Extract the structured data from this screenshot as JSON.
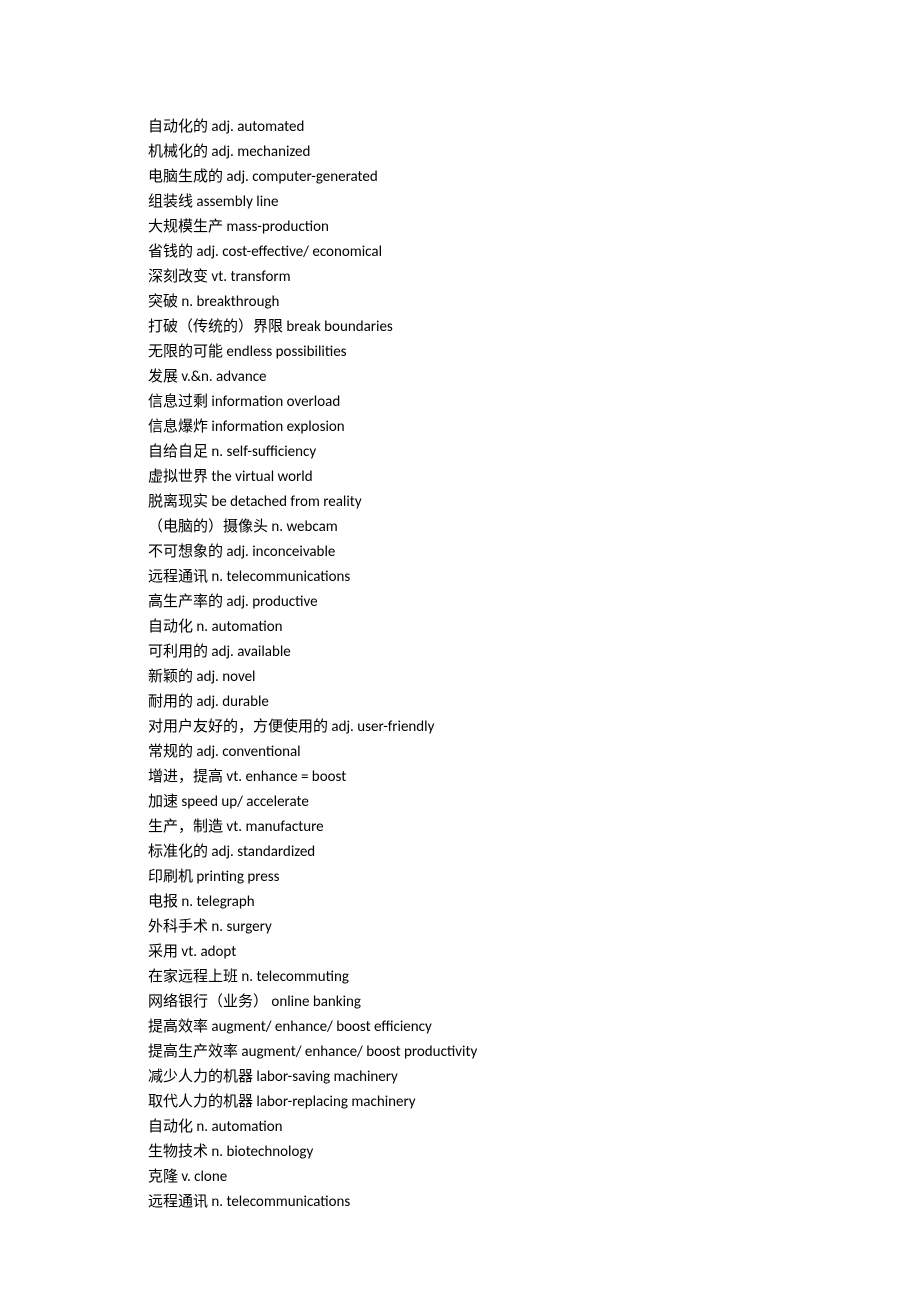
{
  "vocabulary": [
    {
      "cn": "自动化的",
      "en": " adj. automated"
    },
    {
      "cn": "机械化的",
      "en": " adj. mechanized"
    },
    {
      "cn": "电脑生成的",
      "en": " adj. computer-generated"
    },
    {
      "cn": "组装线",
      "en": " assembly line"
    },
    {
      "cn": "大规模生产",
      "en": " mass-production"
    },
    {
      "cn": "省钱的",
      "en": " adj. cost-effective/ economical"
    },
    {
      "cn": "深刻改变",
      "en": " vt. transform"
    },
    {
      "cn": "突破",
      "en": " n. breakthrough"
    },
    {
      "cn": "打破（传统的）界限",
      "en": " break boundaries"
    },
    {
      "cn": "无限的可能",
      "en": " endless possibilities"
    },
    {
      "cn": "发展",
      "en": " v.&n. advance"
    },
    {
      "cn": "信息过剩",
      "en": " information overload"
    },
    {
      "cn": "信息爆炸",
      "en": " information explosion"
    },
    {
      "cn": "自给自足",
      "en": " n. self-sufficiency"
    },
    {
      "cn": "虚拟世界",
      "en": " the virtual world"
    },
    {
      "cn": "脱离现实",
      "en": " be detached from reality"
    },
    {
      "cn": "（电脑的）摄像头",
      "en": " n. webcam"
    },
    {
      "cn": "不可想象的",
      "en": " adj. inconceivable"
    },
    {
      "cn": "远程通讯",
      "en": " n. telecommunications"
    },
    {
      "cn": "高生产率的",
      "en": " adj. productive"
    },
    {
      "cn": "自动化",
      "en": " n. automation"
    },
    {
      "cn": "可利用的",
      "en": " adj. available"
    },
    {
      "cn": "新颖的",
      "en": " adj. novel"
    },
    {
      "cn": "耐用的",
      "en": " adj. durable"
    },
    {
      "cn": "对用户友好的，方便使用的",
      "en": " adj. user-friendly"
    },
    {
      "cn": "常规的",
      "en": " adj. conventional"
    },
    {
      "cn": "增进，提高",
      "en": " vt. enhance = boost"
    },
    {
      "cn": "加速",
      "en": " speed up/ accelerate"
    },
    {
      "cn": "生产，制造",
      "en": " vt. manufacture"
    },
    {
      "cn": "标准化的",
      "en": " adj. standardized"
    },
    {
      "cn": "印刷机",
      "en": " printing press"
    },
    {
      "cn": "电报",
      "en": " n. telegraph"
    },
    {
      "cn": "外科手术",
      "en": " n. surgery"
    },
    {
      "cn": "采用",
      "en": " vt. adopt"
    },
    {
      "cn": "在家远程上班",
      "en": " n. telecommuting"
    },
    {
      "cn": "网络银行（业务）",
      "en": "  online banking"
    },
    {
      "cn": "提高效率",
      "en": " augment/ enhance/ boost efficiency"
    },
    {
      "cn": "提高生产效率",
      "en": " augment/ enhance/ boost productivity"
    },
    {
      "cn": "减少人力的机器",
      "en": " labor-saving machinery"
    },
    {
      "cn": "取代人力的机器",
      "en": " labor-replacing machinery"
    },
    {
      "cn": "自动化",
      "en": " n. automation"
    },
    {
      "cn": "生物技术",
      "en": " n. biotechnology"
    },
    {
      "cn": "克隆",
      "en": " v. clone"
    },
    {
      "cn": "远程通讯",
      "en": " n. telecommunications"
    }
  ]
}
